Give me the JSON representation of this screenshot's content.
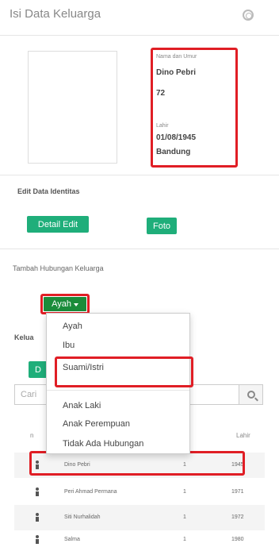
{
  "header": {
    "title": "Isi Data Keluarga",
    "settings_icon": "gear-icon"
  },
  "profile": {
    "name_age_label": "Nama dan Umur",
    "name": "Dino Pebri",
    "age": "72",
    "birth_label": "Lahir",
    "birth_date": "01/08/1945",
    "birth_place": "Bandung"
  },
  "edit_identity": {
    "label": "Edit Data Identitas",
    "detail_edit_button": "Detail Edit",
    "foto_button": "Foto"
  },
  "add_relation": {
    "label": "Tambah Hubungan Keluarga",
    "selected": "Ayah",
    "options": [
      "Ayah",
      "Ibu",
      "Suami/Istri",
      "Anak Laki",
      "Anak Perempuan",
      "Tidak Ada Hubungan"
    ]
  },
  "family": {
    "label_partial": "Kelua",
    "button_partial": "D",
    "search_placeholder": "Cari",
    "col_1_partial": "n",
    "col_lahir": "Lahir",
    "rows": [
      {
        "name": "Dino Pebri",
        "num": "1",
        "year": "1945"
      },
      {
        "name": "Peri Ahmad Permana",
        "num": "1",
        "year": "1971"
      },
      {
        "name": "Siti Nurhalidah",
        "num": "1",
        "year": "1972"
      },
      {
        "name": "Salma",
        "num": "1",
        "year": "1980"
      }
    ]
  },
  "colors": {
    "button_green": "#1fae7a",
    "ayah_green": "#1a8c3a",
    "highlight_red": "#e01e25"
  }
}
